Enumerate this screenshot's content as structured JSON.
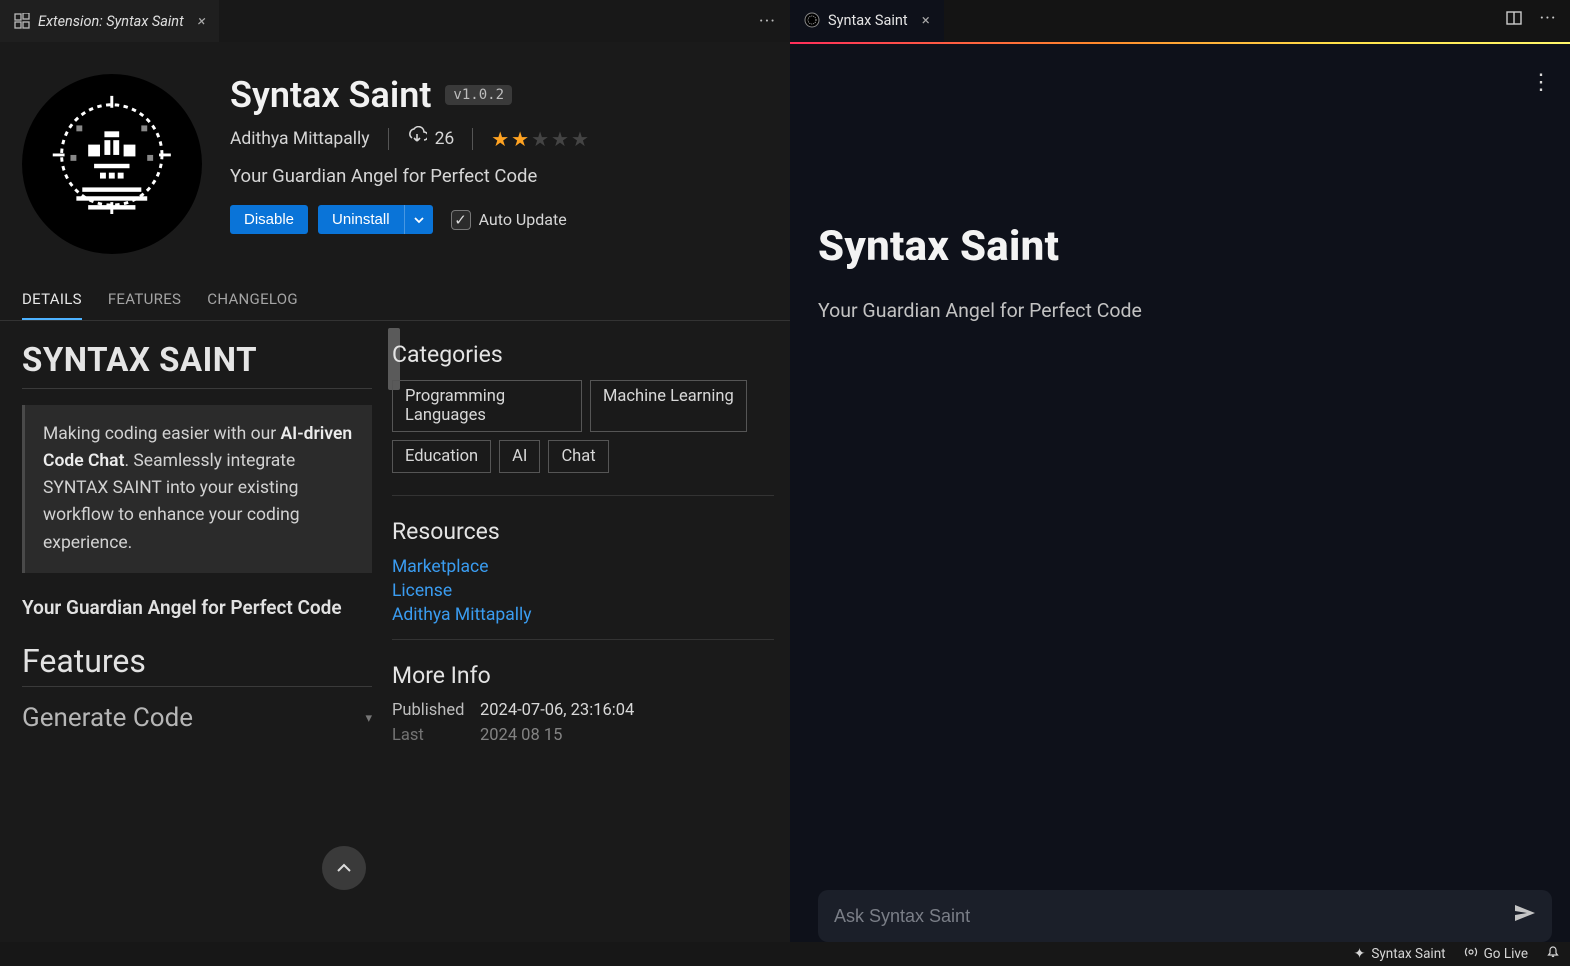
{
  "leftTab": {
    "title": "Extension: Syntax Saint"
  },
  "rightTab": {
    "title": "Syntax Saint"
  },
  "ext": {
    "name": "Syntax Saint",
    "version": "v1.0.2",
    "publisher": "Adithya Mittapally",
    "installs": "26",
    "tagline": "Your Guardian Angel for Perfect Code",
    "disable": "Disable",
    "uninstall": "Uninstall",
    "auto_update": "Auto Update"
  },
  "subtabs": {
    "details": "DETAILS",
    "features": "FEATURES",
    "changelog": "CHANGELOG"
  },
  "readme": {
    "h1": "SYNTAX SAINT",
    "quote_pre": "Making coding easier with our ",
    "quote_bold": "AI-driven Code Chat",
    "quote_post": ". Seamlessly integrate SYNTAX SAINT into your existing workflow to enhance your coding experience.",
    "sub_tagline": "Your Guardian Angel for Perfect Code",
    "features_h": "Features",
    "gen_h": "Generate Code"
  },
  "sidebar": {
    "categories_h": "Categories",
    "categories": [
      "Programming Languages",
      "Machine Learning",
      "Education",
      "AI",
      "Chat"
    ],
    "resources_h": "Resources",
    "resources": [
      "Marketplace",
      "License",
      "Adithya Mittapally"
    ],
    "moreinfo_h": "More Info",
    "published_k": "Published",
    "published_v": "2024-07-06, 23:16:04",
    "last_k": "Last",
    "last_v": "2024 08 15"
  },
  "chat": {
    "title": "Syntax Saint",
    "subtitle": "Your Guardian Angel for Perfect Code",
    "placeholder": "Ask Syntax Saint"
  },
  "status": {
    "app": "Syntax Saint",
    "golive": "Go Live"
  }
}
